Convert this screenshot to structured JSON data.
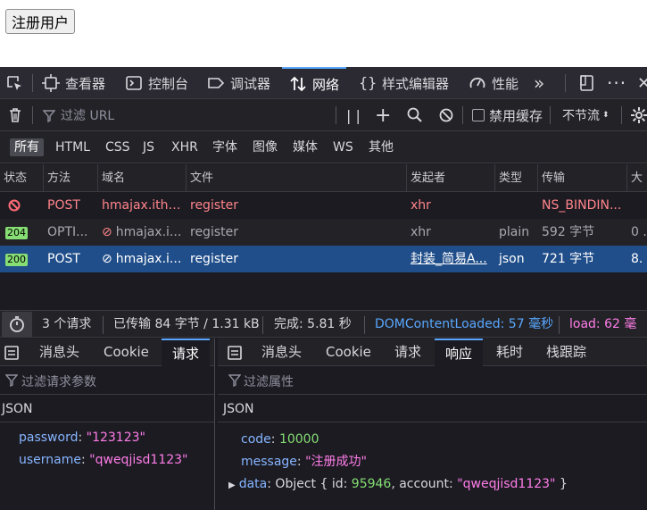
{
  "page": {
    "register_button": "注册用户"
  },
  "toolbar": {
    "tabs": [
      {
        "label": "查看器",
        "icon": "inspector-icon"
      },
      {
        "label": "控制台",
        "icon": "console-icon"
      },
      {
        "label": "调试器",
        "icon": "debugger-icon"
      },
      {
        "label": "网络",
        "icon": "network-icon"
      },
      {
        "label": "样式编辑器",
        "icon": "style-editor-icon"
      },
      {
        "label": "性能",
        "icon": "performance-icon"
      }
    ],
    "active_tab": "网络"
  },
  "filter": {
    "placeholder": "过滤 URL",
    "disable_cache_label": "禁用缓存",
    "throttle_label": "不节流"
  },
  "type_filters": [
    "所有",
    "HTML",
    "CSS",
    "JS",
    "XHR",
    "字体",
    "图像",
    "媒体",
    "WS",
    "其他"
  ],
  "table": {
    "headers": [
      "状态",
      "方法",
      "域名",
      "文件",
      "发起者",
      "类型",
      "传输",
      "大"
    ],
    "rows": [
      {
        "status": "",
        "method": "POST",
        "domain": "hmajax.ithe...",
        "file": "register",
        "initiator": "xhr",
        "type": "",
        "transfer": "NS_BINDIN...",
        "size": ""
      },
      {
        "status": "204",
        "method": "OPTI...",
        "domain": "hmajax.i...",
        "file": "register",
        "initiator": "xhr",
        "type": "plain",
        "transfer": "592 字节",
        "size": "0 ."
      },
      {
        "status": "200",
        "method": "POST",
        "domain": "hmajax.i...",
        "file": "register",
        "initiator": "封装_简易A...",
        "type": "json",
        "transfer": "721 字节",
        "size": "8."
      }
    ]
  },
  "status": {
    "requests": "3 个请求",
    "transferred": "已传输 84 字节 / 1.31 kB",
    "finish": "完成: 5.81 秒",
    "dom_loaded": "DOMContentLoaded: 57 毫秒",
    "load": "load: 62 毫秒"
  },
  "left_panel": {
    "tabs": [
      "消息头",
      "Cookie",
      "请求"
    ],
    "active": "请求",
    "filter_placeholder": "过滤请求参数",
    "section": "JSON",
    "fields": [
      {
        "key": "password",
        "value": "\"123123\""
      },
      {
        "key": "username",
        "value": "\"qweqjisd1123\""
      }
    ]
  },
  "right_panel": {
    "tabs": [
      "消息头",
      "Cookie",
      "请求",
      "响应",
      "耗时",
      "栈跟踪"
    ],
    "active": "响应",
    "filter_placeholder": "过滤属性",
    "section": "JSON",
    "code_key": "code",
    "code_value": "10000",
    "message_key": "message",
    "message_value": "\"注册成功\"",
    "data_key": "data",
    "data_prefix": "Object { id:",
    "data_id": "95946",
    "data_mid": ", account:",
    "data_account": "\"qweqjisd1123\"",
    "data_suffix": "}"
  },
  "colors": {
    "accent": "#59a7ff",
    "error": "#ff848b",
    "selected_row": "#204e8a",
    "badge_ok": "#86de74",
    "dom_loaded": "#59a7ff",
    "load": "#ff7de9"
  }
}
